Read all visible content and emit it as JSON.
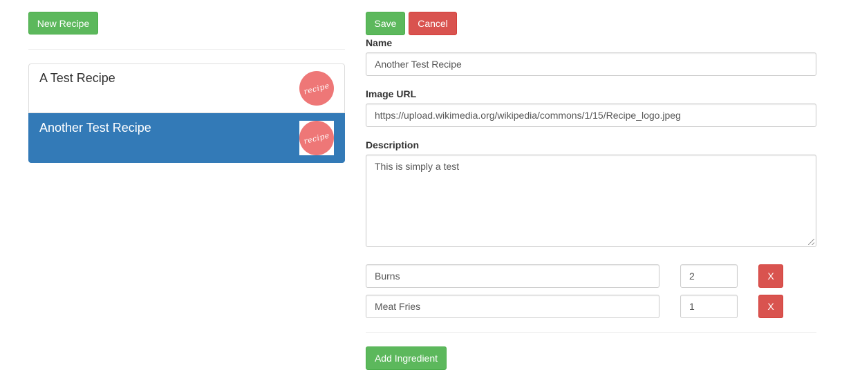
{
  "toolbar": {
    "new_recipe_label": "New Recipe",
    "save_label": "Save",
    "cancel_label": "Cancel"
  },
  "recipes": [
    {
      "title": "A Test Recipe",
      "thumb_text": "recipe",
      "active": false
    },
    {
      "title": "Another Test Recipe",
      "thumb_text": "recipe",
      "active": true
    }
  ],
  "form": {
    "name_label": "Name",
    "name_value": "Another Test Recipe",
    "image_url_label": "Image URL",
    "image_url_value": "https://upload.wikimedia.org/wikipedia/commons/1/15/Recipe_logo.jpeg",
    "description_label": "Description",
    "description_value": "This is simply a test",
    "ingredients": [
      {
        "name": "Burns",
        "amount": "2",
        "remove_label": "X"
      },
      {
        "name": "Meat Fries",
        "amount": "1",
        "remove_label": "X"
      }
    ],
    "add_ingredient_label": "Add Ingredient"
  },
  "colors": {
    "success": "#5cb85c",
    "danger": "#d9534f",
    "active": "#337ab7",
    "thumb": "#ee7777"
  }
}
